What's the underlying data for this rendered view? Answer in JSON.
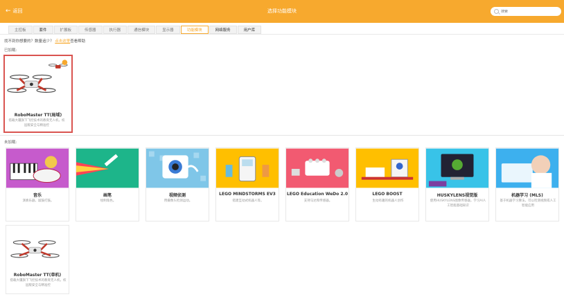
{
  "header": {
    "back_label": "返回",
    "title": "选择功能模块",
    "search_placeholder": "搜索"
  },
  "tabs": [
    {
      "label": "主控板"
    },
    {
      "label": "套件"
    },
    {
      "label": "扩展板"
    },
    {
      "label": "传感器"
    },
    {
      "label": "执行器"
    },
    {
      "label": "通信模块"
    },
    {
      "label": "显示器"
    },
    {
      "label": "功能模块"
    },
    {
      "label": "网络服务"
    },
    {
      "label": "用户库"
    }
  ],
  "hint": {
    "text": "找不到你想要的？数量追少？",
    "link": "点击这里",
    "suffix": "查看帮助"
  },
  "loaded_label": "已加载:",
  "unloaded_label": "未加载:",
  "loaded": [
    {
      "name": "RoboMaster TT(局域)",
      "desc": "搭载大疆旗下飞控技术的教育无人机，校园版安全与精准控"
    }
  ],
  "unloaded": [
    {
      "name": "音乐",
      "desc": "演奏乐器，敲鼓打鼓。"
    },
    {
      "name": "画笔",
      "desc": "绘制角色。"
    },
    {
      "name": "视频侦测",
      "desc": "用摄像头检测运动。"
    },
    {
      "name": "LEGO MINDSTORMS EV3",
      "desc": "搭建互动式机器人等。"
    },
    {
      "name": "LEGO Education WeDo 2.0",
      "desc": "支持马达和传感器。"
    },
    {
      "name": "LEGO BOOST",
      "desc": "生动有趣的机器人创作"
    },
    {
      "name": "HUSKYLENS视觉版",
      "desc": "使用HUSKYLENS图像传感器，学习AI人工智能基础知识"
    },
    {
      "name": "机器学习 (MLS)",
      "desc": "基于机器学习算法，可以检测视频或人工智能应用"
    },
    {
      "name": "RoboMaster TT(单机)",
      "desc": "搭载大疆旗下飞控技术的教育无人机，校园版安全与精准控"
    }
  ],
  "colors": {
    "accent": "#f7a92e",
    "selected_border": "#d9534f"
  }
}
